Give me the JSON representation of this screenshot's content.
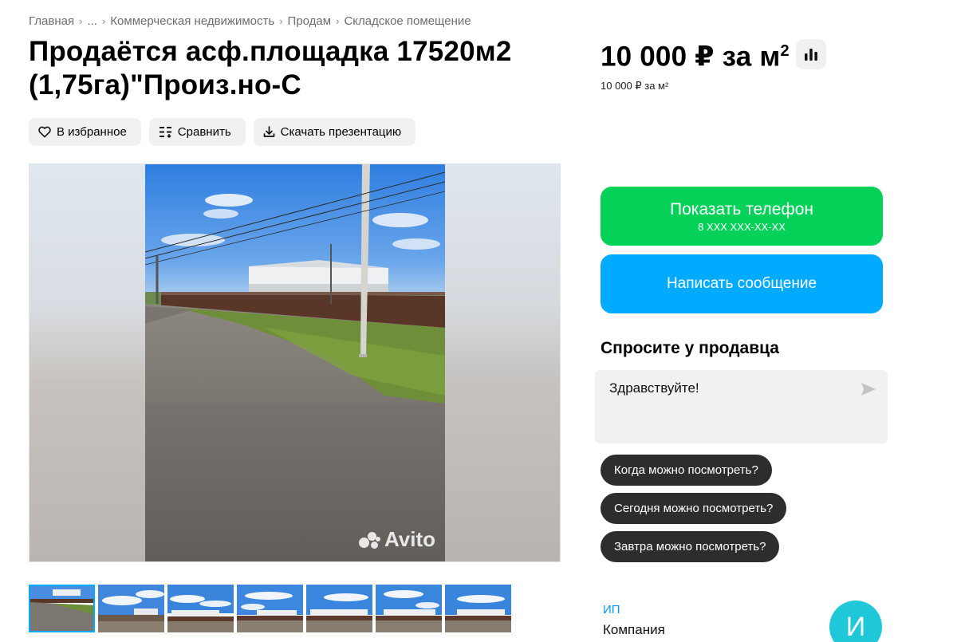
{
  "breadcrumbs": [
    "Главная",
    "...",
    "Коммерческая недвижимость",
    "Продам",
    "Складское помещение"
  ],
  "title": "Продаётся асф.площадка 17520м2 (1,75га)\"Произ.но-С",
  "price": {
    "main": "10 000 ₽ за м",
    "main_sup": "2",
    "sub": "10 000 ₽ за м²"
  },
  "actions": {
    "favorite": "В избранное",
    "compare": "Сравнить",
    "download": "Скачать презентацию"
  },
  "gallery": {
    "watermark": "Avito",
    "thumbnail_count": 7
  },
  "contact": {
    "show_phone": "Показать телефон",
    "phone_masked": "8 XXX XXX-XX-XX",
    "write_message": "Написать сообщение"
  },
  "ask": {
    "title": "Спросите у продавца",
    "input_value": "Здравствуйте!",
    "quick_questions": [
      "Когда можно посмотреть?",
      "Сегодня можно посмотреть?",
      "Завтра можно посмотреть?"
    ]
  },
  "seller": {
    "type": "ИП",
    "name": "Компания",
    "avatar_letter": "И"
  },
  "colors": {
    "phone_button": "#04d158",
    "message_button": "#00aaff",
    "chip_bg": "#2d2d2d",
    "avatar_bg": "#1ec8d8"
  }
}
